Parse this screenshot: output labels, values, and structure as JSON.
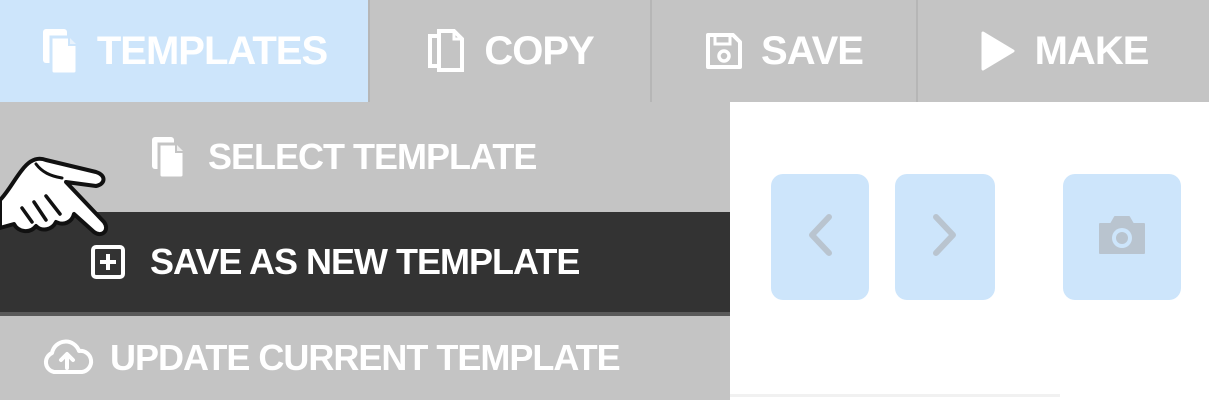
{
  "toolbar": {
    "templates": {
      "label": "TEMPLATES",
      "icon": "templates-icon",
      "active": true
    },
    "copy": {
      "label": "COPY",
      "icon": "copy-icon"
    },
    "save": {
      "label": "SAVE",
      "icon": "floppy-disk-icon"
    },
    "make": {
      "label": "MAKE",
      "icon": "play-icon"
    }
  },
  "menu": {
    "select_template": {
      "label": "SELECT TEMPLATE",
      "icon": "templates-icon"
    },
    "save_as_new": {
      "label": "SAVE AS NEW TEMPLATE",
      "icon": "plus-square-icon",
      "highlighted": true
    },
    "update_current": {
      "label": "UPDATE CURRENT TEMPLATE",
      "icon": "cloud-upload-icon"
    }
  },
  "panel": {
    "prev_icon": "chevron-left-icon",
    "next_icon": "chevron-right-icon",
    "camera_icon": "camera-icon"
  },
  "colors": {
    "toolbar_bg": "#c4c4c4",
    "active_tab_bg": "#cde5fb",
    "highlight_bg": "#333333",
    "text": "#ffffff",
    "panel_button_bg": "#cde5fb"
  }
}
